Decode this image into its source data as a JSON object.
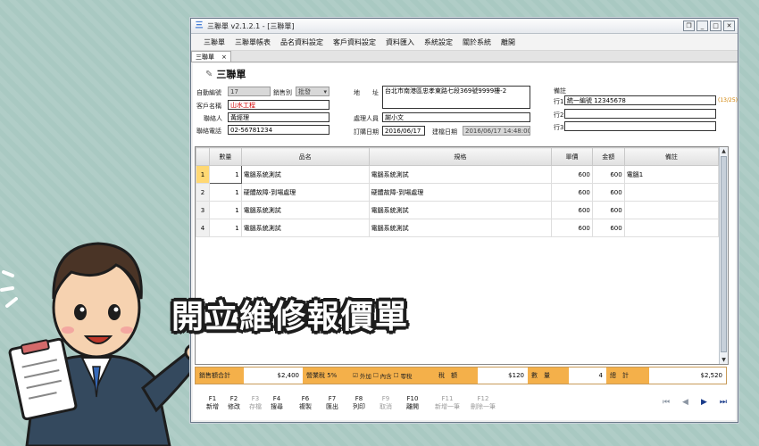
{
  "window": {
    "title": "三聯單 v2.1.2.1 - [三聯單]",
    "app_icon": "三"
  },
  "menu": [
    "三聯單",
    "三聯單帳表",
    "品名資料設定",
    "客戶資料設定",
    "資料匯入",
    "系統設定",
    "關於系統",
    "離開"
  ],
  "tab": {
    "label": "三聯單",
    "close": "×"
  },
  "doc_title": "三聯單",
  "form": {
    "auto_no_label": "自動編號",
    "auto_no": "17",
    "sales_type_label": "銷售別",
    "sales_type": "批發",
    "address_label": "地　　址",
    "address": "台北市南港區忠孝東路七段369號9999樓-2",
    "customer_label": "客戶名稱",
    "customer": "山水工程",
    "contact_label": "聯絡人",
    "contact": "黃經理",
    "handler_label": "處理人員",
    "handler": "謝小文",
    "phone_label": "聯絡電話",
    "phone": "02-56781234",
    "order_date_label": "訂購日期",
    "order_date": "2016/06/17",
    "created_label": "建檔日期",
    "created": "2016/06/17 14:48:00",
    "remark_label": "備註",
    "row1_label": "行1",
    "row1": "統一編號 12345678",
    "row1_counter": "(13/25)",
    "row2_label": "行2",
    "row2": "",
    "row3_label": "行3",
    "row3": ""
  },
  "grid": {
    "headers": [
      "數量",
      "品名",
      "規格",
      "單價",
      "金額",
      "備註"
    ],
    "rows": [
      {
        "idx": "1",
        "qty": "1",
        "name": "電腦系統測試",
        "spec": "電腦系統測試",
        "price": "600",
        "amount": "600",
        "note": "電腦1"
      },
      {
        "idx": "2",
        "qty": "1",
        "name": "硬體故障-到場處理",
        "spec": "硬體故障-到場處理",
        "price": "600",
        "amount": "600",
        "note": ""
      },
      {
        "idx": "3",
        "qty": "1",
        "name": "電腦系統測試",
        "spec": "電腦系統測試",
        "price": "600",
        "amount": "600",
        "note": ""
      },
      {
        "idx": "4",
        "qty": "1",
        "name": "電腦系統測試",
        "spec": "電腦系統測試",
        "price": "600",
        "amount": "600",
        "note": ""
      }
    ]
  },
  "summary": {
    "sales_total_label": "銷售額合計",
    "sales_total": "$2,400",
    "tax_label": "營業稅 5%",
    "tax_opt_ext": "外加",
    "tax_opt_inc": "內含",
    "tax_opt_zero": "零稅",
    "tax_amount_label": "稅　額",
    "tax_amount": "$120",
    "qty_label": "數　量",
    "qty": "4",
    "total_label": "總　計",
    "total": "$2,520"
  },
  "fkeys": [
    {
      "key": "F1",
      "label": "新增",
      "enabled": true
    },
    {
      "key": "F2",
      "label": "修改",
      "enabled": true
    },
    {
      "key": "F3",
      "label": "存檔",
      "enabled": false
    },
    {
      "key": "F4",
      "label": "搜尋",
      "enabled": true
    },
    {
      "key": "F6",
      "label": "複製",
      "enabled": true
    },
    {
      "key": "F7",
      "label": "匯出",
      "enabled": true
    },
    {
      "key": "F8",
      "label": "列印",
      "enabled": true
    },
    {
      "key": "F9",
      "label": "取消",
      "enabled": false
    },
    {
      "key": "F10",
      "label": "離開",
      "enabled": true
    },
    {
      "key": "F11",
      "label": "新增一筆",
      "enabled": false
    },
    {
      "key": "F12",
      "label": "刪除一筆",
      "enabled": false
    }
  ],
  "nav_icons": [
    "first-record-icon",
    "prev-record-icon",
    "next-record-icon",
    "last-record-icon"
  ],
  "banner": "開立維修報價單",
  "colors": {
    "accent_orange": "#f4b04a",
    "background": "#a9c9c2"
  }
}
